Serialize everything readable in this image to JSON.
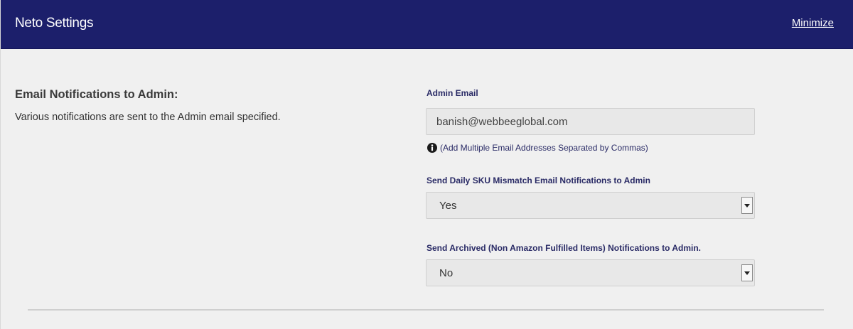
{
  "header": {
    "title": "Neto Settings",
    "minimize_label": "Minimize"
  },
  "section": {
    "heading": "Email Notifications to Admin:",
    "description": "Various notifications are sent to the Admin email specified."
  },
  "admin_email": {
    "label": "Admin Email",
    "value": "banish@webbeeglobal.com",
    "hint": "(Add Multiple Email Addresses Separated by Commas)",
    "hint_icon": "info-icon"
  },
  "sku_mismatch": {
    "label": "Send Daily SKU Mismatch Email Notifications to Admin",
    "selected": "Yes"
  },
  "archived": {
    "label": "Send Archived (Non Amazon Fulfilled Items) Notifications to Admin.",
    "selected": "No"
  },
  "colors": {
    "header_bg": "#1c1f6b",
    "panel_bg": "#f0f0f0",
    "label_color": "#2a2b66"
  }
}
